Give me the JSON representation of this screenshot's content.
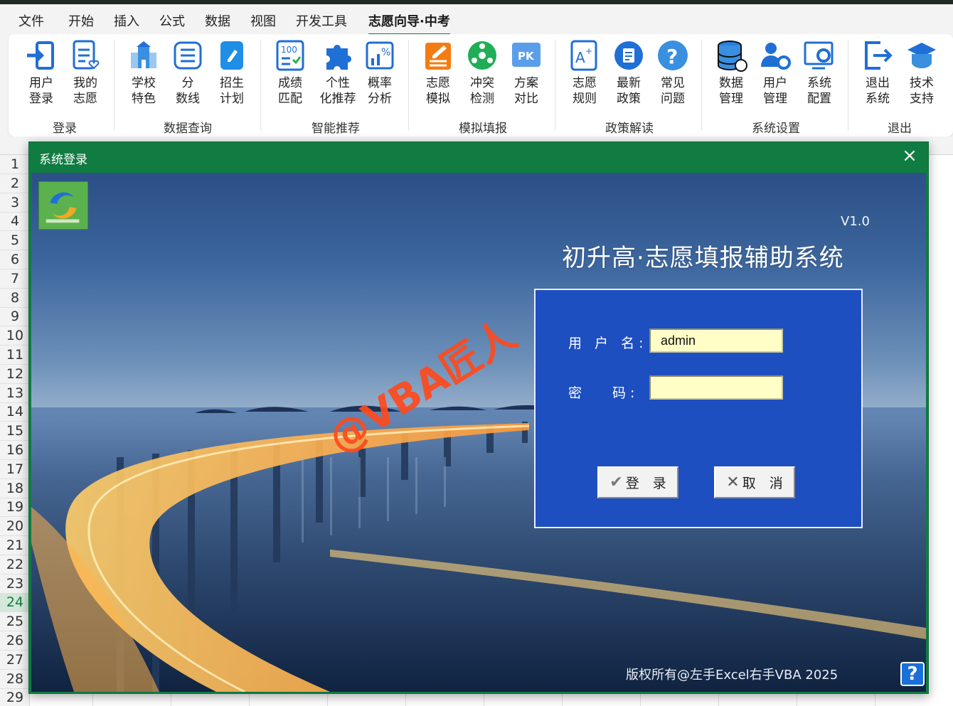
{
  "menu": {
    "tabs": [
      {
        "label": "文件"
      },
      {
        "label": "开始"
      },
      {
        "label": "插入"
      },
      {
        "label": "公式"
      },
      {
        "label": "数据"
      },
      {
        "label": "视图"
      },
      {
        "label": "开发工具"
      },
      {
        "label": "志愿向导·中考"
      }
    ]
  },
  "ribbon": {
    "groups": [
      {
        "label": "登录",
        "buttons": [
          {
            "label": "用户\n登录",
            "icon": "login-icon"
          },
          {
            "label": "我的\n志愿",
            "icon": "my-wish-icon"
          }
        ]
      },
      {
        "label": "数据查询",
        "buttons": [
          {
            "label": "学校\n特色",
            "icon": "school-icon"
          },
          {
            "label": "分\n数线",
            "icon": "score-line-icon"
          },
          {
            "label": "招生\n计划",
            "icon": "plan-icon"
          }
        ]
      },
      {
        "label": "智能推荐",
        "buttons": [
          {
            "label": "成绩\n匹配",
            "icon": "score-match-icon"
          },
          {
            "label": "个性\n化推荐",
            "icon": "puzzle-icon"
          },
          {
            "label": "概率\n分析",
            "icon": "probability-icon"
          }
        ]
      },
      {
        "label": "模拟填报",
        "buttons": [
          {
            "label": "志愿\n模拟",
            "icon": "simulate-icon"
          },
          {
            "label": "冲突\n检测",
            "icon": "conflict-icon"
          },
          {
            "label": "方案\n对比",
            "icon": "pk-icon"
          }
        ]
      },
      {
        "label": "政策解读",
        "buttons": [
          {
            "label": "志愿\n规则",
            "icon": "rule-icon"
          },
          {
            "label": "最新\n政策",
            "icon": "policy-icon"
          },
          {
            "label": "常见\n问题",
            "icon": "question-icon"
          }
        ]
      },
      {
        "label": "系统设置",
        "buttons": [
          {
            "label": "数据\n管理",
            "icon": "database-icon"
          },
          {
            "label": "用户\n管理",
            "icon": "user-manage-icon"
          },
          {
            "label": "系统\n配置",
            "icon": "config-icon"
          }
        ]
      },
      {
        "label": "退出",
        "buttons": [
          {
            "label": "退出\n系统",
            "icon": "exit-icon"
          },
          {
            "label": "技术\n支持",
            "icon": "support-icon"
          }
        ]
      }
    ]
  },
  "sheet": {
    "rows": [
      "1",
      "2",
      "3",
      "4",
      "5",
      "6",
      "7",
      "8",
      "9",
      "10",
      "11",
      "12",
      "13",
      "14",
      "15",
      "16",
      "17",
      "18",
      "19",
      "20",
      "21",
      "22",
      "23",
      "24",
      "25",
      "26",
      "27",
      "28",
      "29"
    ],
    "selected_row": "24"
  },
  "dialog": {
    "title": "系统登录",
    "close": "×",
    "version": "V1.0",
    "app_title": "初升高·志愿填报辅助系统",
    "username_label": "用 户 名:",
    "username_value": "admin",
    "password_label": "密　 码:",
    "password_value": "",
    "login_label": "登　录",
    "login_icon": "✔",
    "cancel_label": "取　消",
    "cancel_icon": "✕",
    "watermark": "@VBA匠人",
    "copyright": "版权所有@左手Excel右手VBA 2025",
    "help": "?"
  },
  "colors": {
    "excel_green": "#107c41",
    "panel_blue": "#1e4fc0",
    "input_yellow": "#fffec6",
    "watermark": "#ff4a1c"
  }
}
